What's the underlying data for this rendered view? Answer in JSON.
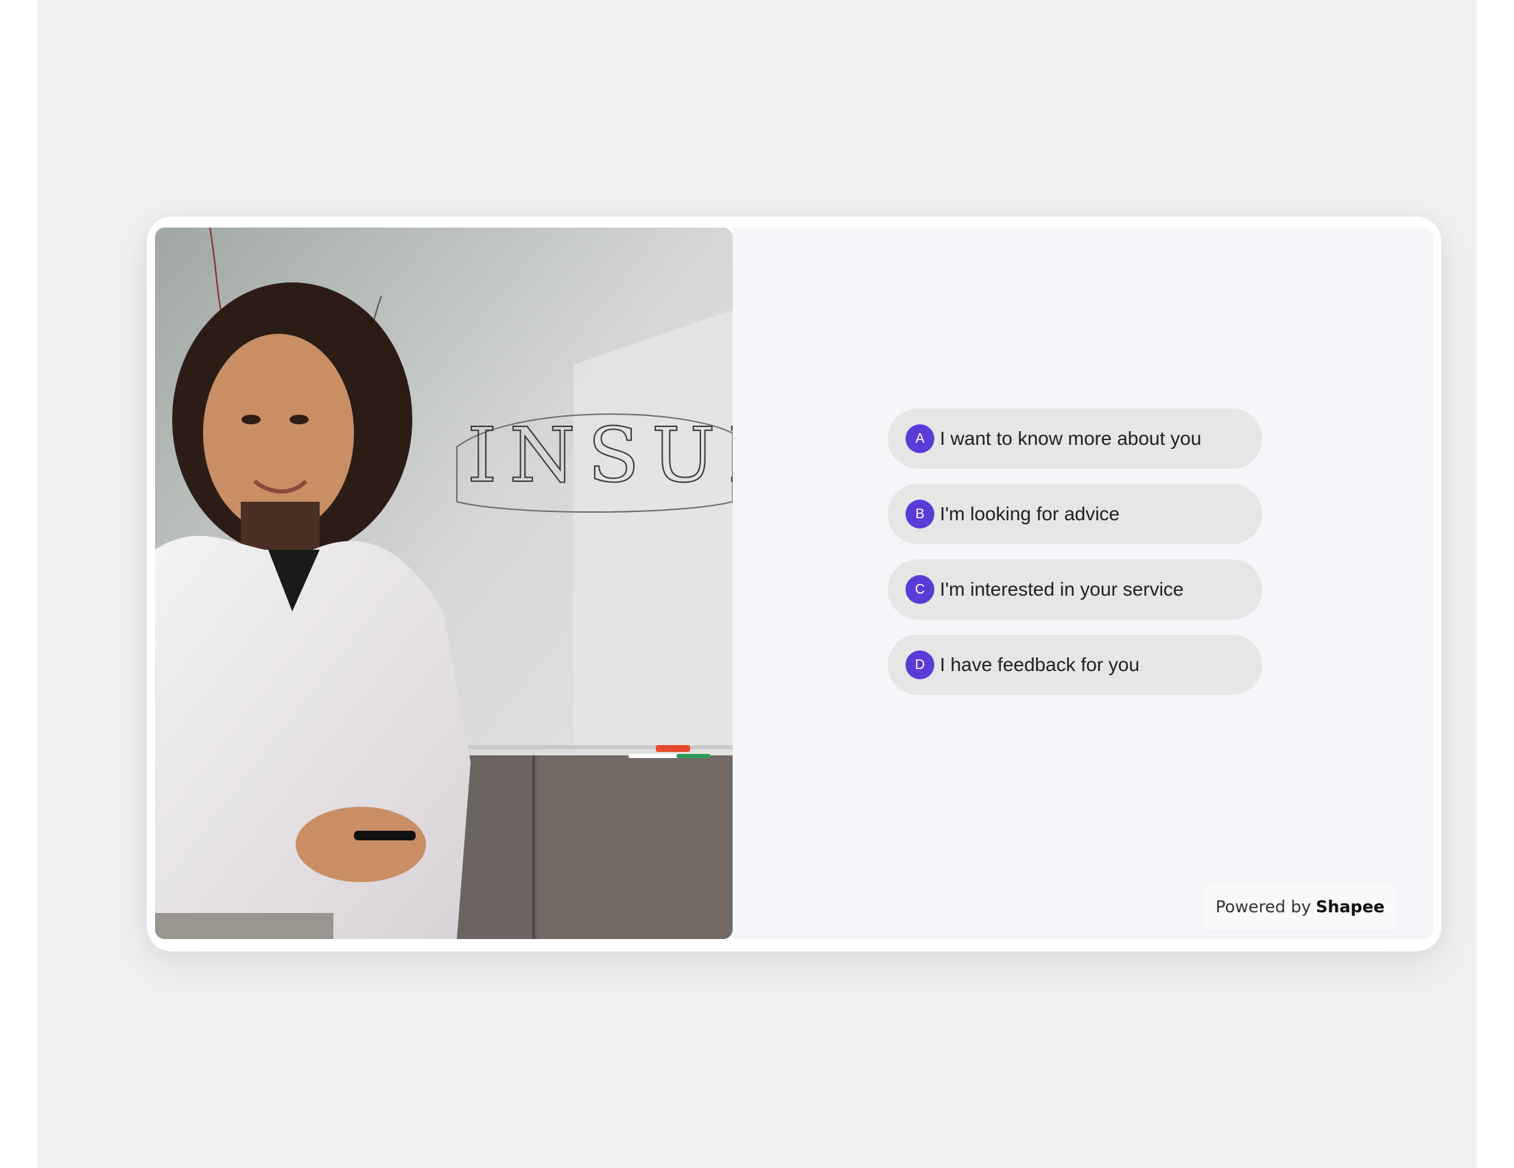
{
  "options": [
    {
      "letter": "A",
      "label": "I want to know more about you"
    },
    {
      "letter": "B",
      "label": "I'm looking for advice"
    },
    {
      "letter": "C",
      "label": "I'm interested in your service"
    },
    {
      "letter": "D",
      "label": "I have feedback for you"
    }
  ],
  "footer": {
    "powered_prefix": "Powered by",
    "brand": "Shapee"
  },
  "photo": {
    "whiteboard_text": "INSURA"
  },
  "colors": {
    "badge": "#5a3bd6",
    "option_bg": "#e6e6e6",
    "panel_bg": "#f5f6f9"
  }
}
